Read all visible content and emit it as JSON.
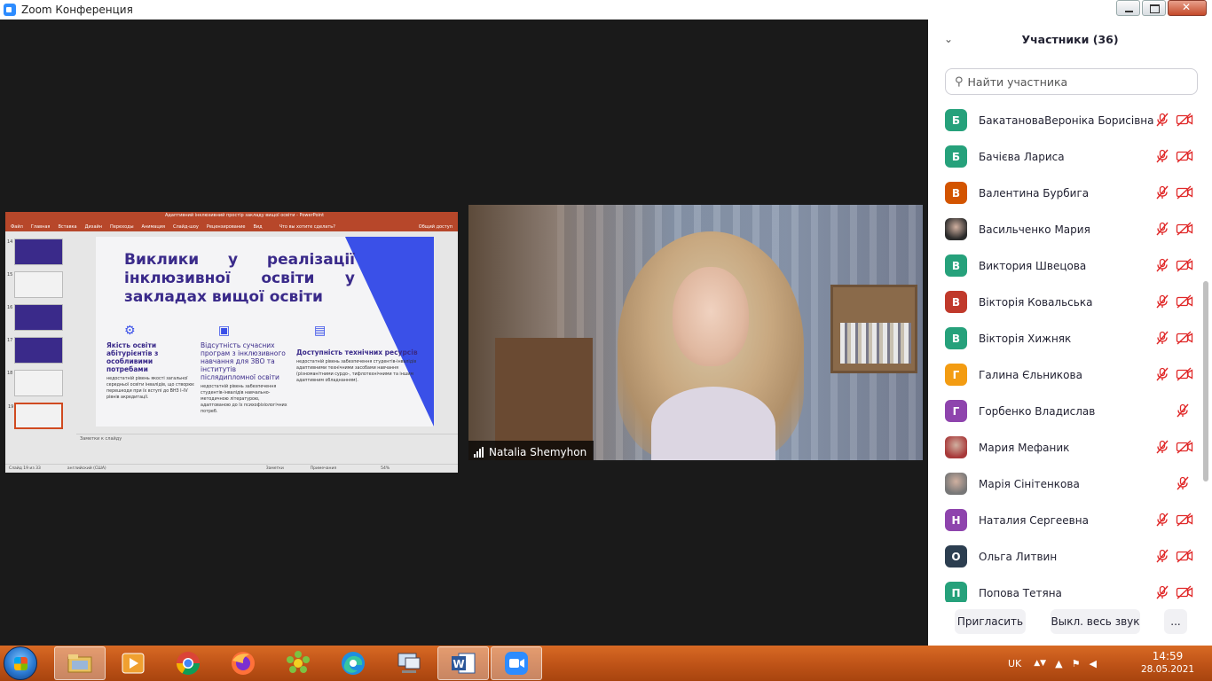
{
  "window": {
    "title": "Zoom Конференция"
  },
  "shared_screen": {
    "window_title": "Адаптивний інклюзивний простір закладу вищої освіти - PowerPoint",
    "ribbon_tabs": [
      "Файл",
      "Главная",
      "Вставка",
      "Дизайн",
      "Переходы",
      "Анимация",
      "Слайд-шоу",
      "Рецензирование",
      "Вид"
    ],
    "ribbon_search": "Что вы хотите сделать?",
    "ribbon_share": "Общий доступ",
    "thumb_numbers": [
      "14",
      "15",
      "16",
      "17",
      "18",
      "19"
    ],
    "slide": {
      "title": "Виклики у реалізації інклюзивної освіти у закладах вищої освіти",
      "columns": [
        {
          "icon": "gear-icon",
          "heading": "Якість освіти абітурієнтів з особливими потребами",
          "text": "недостатній рівень якості загальної середньої освіти інвалідів, що створює перешкоди при їх вступі до ВНЗ I–IV рівнів акредитації."
        },
        {
          "icon": "wallet-icon",
          "heading": "Відсутність сучасних програм з інклюзивного навчання для ЗВО та інститутів післядипломної освіти",
          "text": "недостатній рівень забезпечення студентів-інвалідів навчально-методичною літературою, адаптованою до їх психофізіологічних потреб."
        },
        {
          "icon": "document-icon",
          "heading": "Доступність технічних ресурсів",
          "text": "недостатній рівень забезпечення студентів-інвалідів адаптивними технічними засобами навчання (різноманітними сурдо-, тифлотехнічними та іншим адаптивним обладнанням)."
        }
      ]
    },
    "notes_placeholder": "Заметки к слайду",
    "status_slide": "Слайд 19 из 33",
    "status_lang": "английский (США)",
    "status_notes": "Заметки",
    "status_comments": "Примечания",
    "status_zoom": "54%"
  },
  "speaker": {
    "name": "Natalia Shemyhon"
  },
  "participants_panel": {
    "title": "Участники (36)",
    "search_placeholder": "Найти участника",
    "participants": [
      {
        "initial": "Б",
        "name": "БакатановаВероніка Борисівна",
        "color": "#26a17b",
        "mic_muted": true,
        "video_off": true
      },
      {
        "initial": "Б",
        "name": "Бачієва Лариса",
        "color": "#26a17b",
        "mic_muted": true,
        "video_off": true
      },
      {
        "initial": "В",
        "name": "Валентина Бурбига",
        "color": "#d35400",
        "mic_muted": true,
        "video_off": true
      },
      {
        "initial": "",
        "name": "Васильченко Мария",
        "color": "#2b2b2b",
        "mic_muted": true,
        "video_off": true,
        "photo": true
      },
      {
        "initial": "В",
        "name": "Виктория Швецова",
        "color": "#26a17b",
        "mic_muted": true,
        "video_off": true
      },
      {
        "initial": "В",
        "name": "Вікторія Ковальська",
        "color": "#c0392b",
        "mic_muted": true,
        "video_off": true
      },
      {
        "initial": "В",
        "name": "Вікторія Хижняк",
        "color": "#26a17b",
        "mic_muted": true,
        "video_off": true
      },
      {
        "initial": "Г",
        "name": "Галина Єльникова",
        "color": "#f39c12",
        "mic_muted": true,
        "video_off": true
      },
      {
        "initial": "Г",
        "name": "Горбенко Владислав",
        "color": "#8e44ad",
        "mic_muted": true,
        "video_off": false
      },
      {
        "initial": "",
        "name": "Мария Мефаник",
        "color": "#a83a3a",
        "mic_muted": true,
        "video_off": true,
        "photo": true
      },
      {
        "initial": "",
        "name": "Марія Сінітенкова",
        "color": "#777777",
        "mic_muted": true,
        "video_off": false,
        "photo": true
      },
      {
        "initial": "Н",
        "name": "Наталия Сергеевна",
        "color": "#8e44ad",
        "mic_muted": true,
        "video_off": true
      },
      {
        "initial": "О",
        "name": "Ольга Литвин",
        "color": "#2c3e50",
        "mic_muted": true,
        "video_off": true
      },
      {
        "initial": "П",
        "name": "Попова Тетяна",
        "color": "#26a17b",
        "mic_muted": true,
        "video_off": true
      }
    ],
    "buttons": {
      "invite": "Пригласить",
      "mute_all": "Выкл. весь звук",
      "more": "..."
    }
  },
  "taskbar": {
    "apps": [
      "file-explorer-icon",
      "media-player-icon",
      "chrome-icon",
      "firefox-icon",
      "icq-icon",
      "edge-icon",
      "network-icon",
      "word-icon",
      "zoom-icon"
    ],
    "language": "UK",
    "time": "14:59",
    "date": "28.05.2021"
  },
  "colors": {
    "ppt_accent": "#b7472a",
    "slide_blue": "#3a50e8",
    "slide_title": "#3a2a8a",
    "muted_red": "#e02828",
    "taskbar": "#c05418"
  }
}
